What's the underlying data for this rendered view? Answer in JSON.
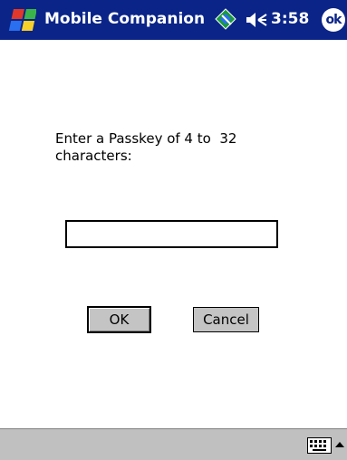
{
  "titlebar": {
    "start_icon": "windows-flag-icon",
    "title": "Mobile Companion",
    "connectivity_icon": "connectivity-icon",
    "speaker_icon": "speaker-icon",
    "time": "3:58",
    "ok_label": "ok",
    "background_color": "#0a2488"
  },
  "dialog": {
    "prompt": "Enter a Passkey of 4 to  32\ncharacters:",
    "passkey_value": "",
    "ok_label": "OK",
    "cancel_label": "Cancel"
  },
  "menubar": {
    "keyboard_icon": "keyboard-icon",
    "sip_arrow_icon": "up-arrow-icon",
    "background_color": "#c0c0c0"
  }
}
